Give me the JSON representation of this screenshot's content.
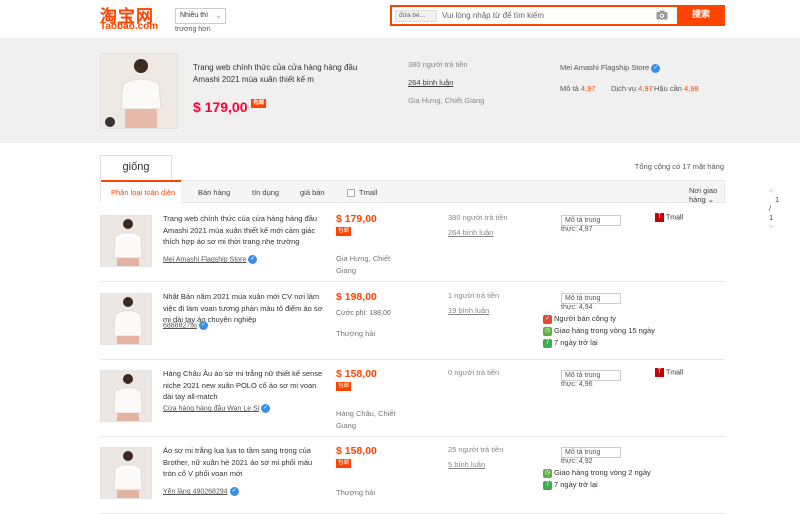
{
  "header": {
    "logo_cn": "淘宝网",
    "logo_en": "Taobao.com",
    "sort_label": "Nhiều thì",
    "sort_sub": "trường hơn",
    "search_scope": "đứa bé...",
    "search_placeholder": "Vui lòng nhập từ để tìm kiếm",
    "search_button": "搜索",
    "brand_color": "#ff4400"
  },
  "summary": {
    "title": "Trang web chính thức của cửa hàng hàng đầu Amashi 2021 mùa xuân thiết kế m",
    "price": "$ 179,00",
    "badge": "包邮",
    "sold": "380 người trả tiền",
    "reviews": "264 bình luận",
    "location": "Gia Hưng, Chiết Giang",
    "store": "Mei Amashi Flagship Store",
    "ratings": [
      {
        "label": "Mô tả",
        "value": "4,97"
      },
      {
        "label": "Dịch vụ",
        "value": "4,97"
      },
      {
        "label": "Hậu cần",
        "value": "4,98"
      }
    ]
  },
  "tabs": {
    "main": "giống",
    "total": "Tổng cộng có 17 mặt hàng"
  },
  "filters": {
    "items": [
      "Phân loại toàn diện",
      "Bán hàng",
      "tín dụng",
      "giá bán",
      "Tmall"
    ],
    "ship_select": "Nơi giao hàng",
    "pager": "1 / 1"
  },
  "rows": [
    {
      "title": "Trang web chính thức của cửa hàng hàng đầu Amashi 2021 mùa xuân thiết kế mới cảm giác thích hợp áo sơ mi thời trang nhẹ trường",
      "seller": "Mei Amashi Flagship Store",
      "price": "$ 179,00",
      "badge": "包邮",
      "cuoc": "",
      "location": "Gia Hưng, Chiết Giang",
      "sold": "380 người trả tiền",
      "reviews": "264 bình luận",
      "mota": "Mô tả trung",
      "thuc": "thực: 4,97",
      "tmall": "Tmall",
      "services": []
    },
    {
      "title": "Nhật Bản năm 2021 mùa xuân mới CV nơi làm việc đi làm voan tương phản màu tô điểm áo sơ mi dài tay áo chuyên nghiệp",
      "seller": "6888827lxj",
      "price": "$ 198,00",
      "badge": "",
      "cuoc": "Cước phí: 188,00",
      "location": "Thượng hải",
      "sold": "1 người trả tiền",
      "reviews": "19 bình luận",
      "mota": "Mô tả trung",
      "thuc": "thực: 4,94",
      "tmall": "",
      "services": [
        "Người bán công ty",
        "Giao hàng trong vòng 15 ngày",
        "7 ngày trở lại"
      ]
    },
    {
      "title": "Hàng Châu Âu áo sơ mi trắng nữ thiết kế sense niche 2021 new xuân POLO cổ áo sơ mi voan dài tay all-match",
      "seller": "Cửa hàng hàng đầu Wan Le Si",
      "price": "$ 158,00",
      "badge": "包邮",
      "cuoc": "",
      "location": "Hàng Châu, Chiết Giang",
      "sold": "0 người trả tiền",
      "reviews": "",
      "mota": "Mô tả trung",
      "thuc": "thực: 4,96",
      "tmall": "Tmall",
      "services": []
    },
    {
      "title": "Áo sơ mi trắng lụa lụa to tầm sang trọng của Brother, nữ xuân hè 2021 áo sơ mi phối màu tròn cổ V phối voan mới",
      "seller": "Yên làng 490268294",
      "price": "$ 158,00",
      "badge": "包邮",
      "cuoc": "",
      "location": "Thượng hải",
      "sold": "25 người trả tiền",
      "reviews": "5 bình luận",
      "mota": "Mô tả trung",
      "thuc": "thực: 4,92",
      "tmall": "",
      "services": [
        "Giao hàng trong vòng 2 ngày",
        "7 ngày trở lại"
      ]
    }
  ]
}
